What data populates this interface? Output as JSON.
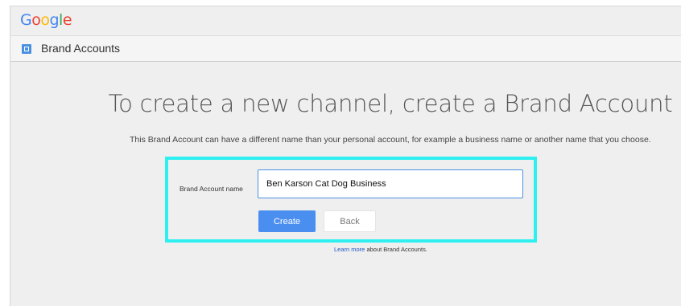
{
  "header": {
    "logo": {
      "letters": [
        "G",
        "o",
        "o",
        "g",
        "l",
        "e"
      ],
      "colors": [
        "#4285F4",
        "#EA4335",
        "#FBBC05",
        "#4285F4",
        "#34A853",
        "#EA4335"
      ]
    },
    "section_title": "Brand Accounts",
    "section_icon": "brand-account-icon"
  },
  "main": {
    "headline": "To create a new channel, create a Brand Account",
    "description": "This Brand Account can have a different name than your personal account, for example a business name or another name that you choose.",
    "form": {
      "label": "Brand Account name",
      "input_value": "Ben Karson Cat Dog Business",
      "create_label": "Create",
      "back_label": "Back"
    },
    "learn_more": {
      "link_text": "Learn more",
      "suffix": " about Brand Accounts."
    }
  },
  "colors": {
    "highlight": "#2ff0f0",
    "primary": "#4a8ff0",
    "link": "#1a56c8"
  }
}
